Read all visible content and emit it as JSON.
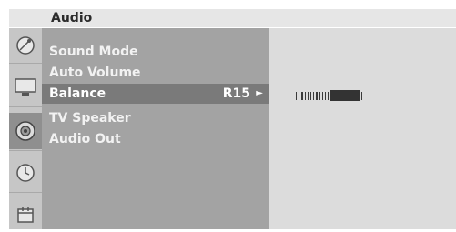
{
  "header": {
    "title": "Audio"
  },
  "icons": [
    {
      "name": "satellite-dish-icon",
      "selected": false
    },
    {
      "name": "tv-picture-icon",
      "selected": false
    },
    {
      "name": "speaker-audio-icon",
      "selected": true
    },
    {
      "name": "clock-time-icon",
      "selected": false
    },
    {
      "name": "calendar-option-icon",
      "selected": false
    }
  ],
  "menu": {
    "items": [
      {
        "label": "Sound Mode"
      },
      {
        "label": "Auto Volume"
      },
      {
        "label": "Balance",
        "value": "R15",
        "arrow": "►",
        "selected": true
      },
      {
        "label": "TV Speaker"
      },
      {
        "label": "Audio Out"
      }
    ]
  },
  "balance": {
    "level_fraction": 0.65,
    "colors": {
      "bar": "#333333"
    }
  },
  "colors": {
    "header_bg": "#e6e6e6",
    "menu_bg": "#a3a3a3",
    "menu_selected_bg": "#7a7a7a",
    "right_panel_bg": "#dcdcdc",
    "icon_col_bg": "#c6c6c6"
  }
}
